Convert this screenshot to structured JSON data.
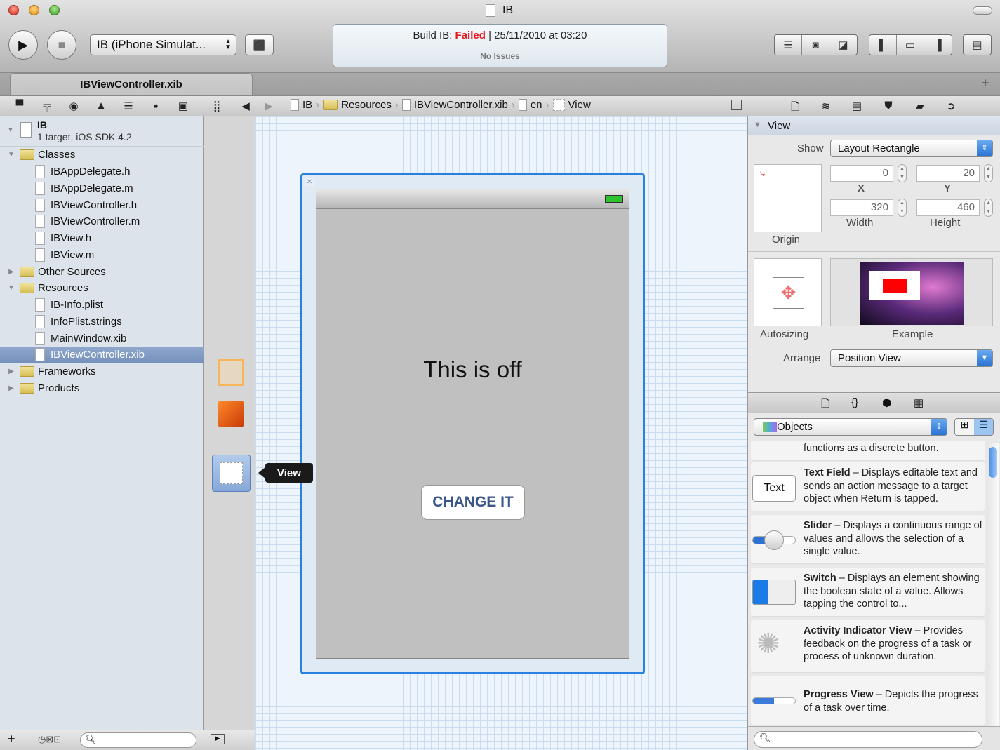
{
  "window": {
    "title": "IB"
  },
  "toolbar": {
    "scheme": "IB (iPhone Simulat...",
    "activity": {
      "prefix": "Build IB: ",
      "status": "Failed",
      "separator": " | ",
      "datetime": "25/11/2010 at 03:20",
      "issues": "No Issues"
    },
    "colors": {
      "failed": "#e8141c"
    }
  },
  "tab": {
    "label": "IBViewController.xib"
  },
  "jumpbar": [
    "IB",
    "Resources",
    "IBViewController.xib",
    "en",
    "View"
  ],
  "navigator": {
    "project": {
      "name": "IB",
      "subtitle": "1 target, iOS SDK 4.2"
    },
    "items": [
      {
        "label": "Classes",
        "type": "folder",
        "level": 0,
        "expanded": true
      },
      {
        "label": "IBAppDelegate.h",
        "type": "file",
        "level": 1
      },
      {
        "label": "IBAppDelegate.m",
        "type": "file",
        "level": 1
      },
      {
        "label": "IBViewController.h",
        "type": "file",
        "level": 1
      },
      {
        "label": "IBViewController.m",
        "type": "file",
        "level": 1
      },
      {
        "label": "IBView.h",
        "type": "file",
        "level": 1
      },
      {
        "label": "IBView.m",
        "type": "file",
        "level": 1
      },
      {
        "label": "Other Sources",
        "type": "folder",
        "level": 0,
        "expanded": false
      },
      {
        "label": "Resources",
        "type": "folder",
        "level": 0,
        "expanded": true
      },
      {
        "label": "IB-Info.plist",
        "type": "file",
        "level": 1
      },
      {
        "label": "InfoPlist.strings",
        "type": "file",
        "level": 1
      },
      {
        "label": "MainWindow.xib",
        "type": "file",
        "level": 1
      },
      {
        "label": "IBViewController.xib",
        "type": "file",
        "level": 1,
        "selected": true
      },
      {
        "label": "Frameworks",
        "type": "folder",
        "level": 0,
        "expanded": false
      },
      {
        "label": "Products",
        "type": "folder",
        "level": 0,
        "expanded": false
      }
    ]
  },
  "dock": {
    "tooltip": "View"
  },
  "canvas": {
    "label_text": "This is off",
    "button_text": "CHANGE IT"
  },
  "inspector": {
    "section": "View",
    "show_label": "Show",
    "show_value": "Layout Rectangle",
    "x": "0",
    "y": "20",
    "width": "320",
    "height": "460",
    "x_label": "X",
    "y_label": "Y",
    "width_label": "Width",
    "height_label": "Height",
    "origin_label": "Origin",
    "autosizing_label": "Autosizing",
    "example_label": "Example",
    "arrange_label": "Arrange",
    "arrange_value": "Position View"
  },
  "library": {
    "selector": "Objects",
    "partial_desc": "functions as a discrete button.",
    "text_field_preview": "Text",
    "items": [
      {
        "name": "Text Field",
        "desc": " – Displays editable text and sends an action message to a target object when Return is tapped."
      },
      {
        "name": "Slider",
        "desc": " – Displays a continuous range of values and allows the selection of a single value."
      },
      {
        "name": "Switch",
        "desc": " – Displays an element showing the boolean state of a value. Allows tapping the control to..."
      },
      {
        "name": "Activity Indicator View",
        "desc": " – Provides feedback on the progress of a task or process of unknown duration."
      },
      {
        "name": "Progress View",
        "desc": " – Depicts the progress of a task over time."
      }
    ]
  }
}
